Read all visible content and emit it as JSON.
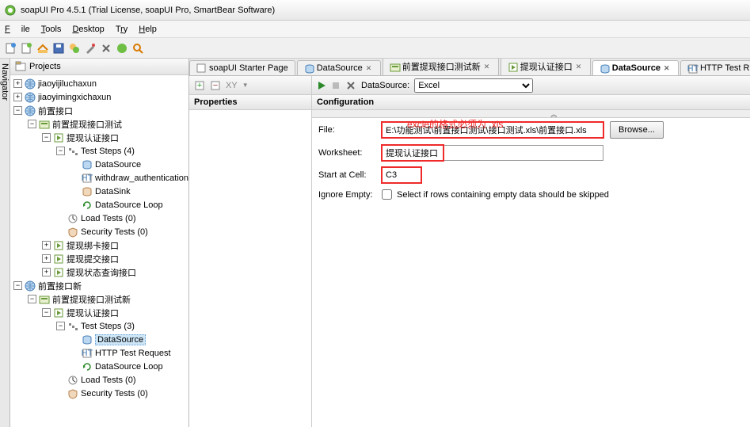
{
  "title": "soapUI Pro 4.5.1 (Trial License, soapUI Pro, SmartBear Software)",
  "menu": {
    "file": "File",
    "tools": "Tools",
    "desktop": "Desktop",
    "try": "Try",
    "help": "Help"
  },
  "navStrip": "Navigator",
  "treeHeader": "Projects",
  "tree": [
    {
      "d": 0,
      "t": "+",
      "i": "globe",
      "l": "jiaoyijiluchaxun"
    },
    {
      "d": 0,
      "t": "+",
      "i": "globe",
      "l": "jiaoyimingxichaxun"
    },
    {
      "d": 0,
      "t": "-",
      "i": "globe",
      "l": "前置接口"
    },
    {
      "d": 1,
      "t": "-",
      "i": "iface",
      "l": "前置提现接口测试"
    },
    {
      "d": 2,
      "t": "-",
      "i": "op",
      "l": "提现认证接口"
    },
    {
      "d": 3,
      "t": "-",
      "i": "steps",
      "l": "Test Steps (4)"
    },
    {
      "d": 4,
      "t": "",
      "i": "ds",
      "l": "DataSource"
    },
    {
      "d": 4,
      "t": "",
      "i": "req",
      "l": "withdraw_authentication"
    },
    {
      "d": 4,
      "t": "",
      "i": "sink",
      "l": "DataSink"
    },
    {
      "d": 4,
      "t": "",
      "i": "loop",
      "l": "DataSource Loop"
    },
    {
      "d": 3,
      "t": "",
      "i": "load",
      "l": "Load Tests (0)"
    },
    {
      "d": 3,
      "t": "",
      "i": "sec",
      "l": "Security Tests (0)"
    },
    {
      "d": 2,
      "t": "+",
      "i": "op",
      "l": "提现绑卡接口"
    },
    {
      "d": 2,
      "t": "+",
      "i": "op",
      "l": "提现提交接口"
    },
    {
      "d": 2,
      "t": "+",
      "i": "op",
      "l": "提现状态查询接口"
    },
    {
      "d": 0,
      "t": "-",
      "i": "globe",
      "l": "前置接口新"
    },
    {
      "d": 1,
      "t": "-",
      "i": "iface",
      "l": "前置提现接口测试新"
    },
    {
      "d": 2,
      "t": "-",
      "i": "op",
      "l": "提现认证接口"
    },
    {
      "d": 3,
      "t": "-",
      "i": "steps",
      "l": "Test Steps (3)"
    },
    {
      "d": 4,
      "t": "",
      "i": "ds",
      "l": "DataSource",
      "sel": true
    },
    {
      "d": 4,
      "t": "",
      "i": "req",
      "l": "HTTP Test Request"
    },
    {
      "d": 4,
      "t": "",
      "i": "loop",
      "l": "DataSource Loop"
    },
    {
      "d": 3,
      "t": "",
      "i": "load",
      "l": "Load Tests (0)"
    },
    {
      "d": 3,
      "t": "",
      "i": "sec",
      "l": "Security Tests (0)"
    }
  ],
  "tabs": [
    {
      "l": "soapUI Starter Page",
      "i": "page",
      "a": false
    },
    {
      "l": "DataSource",
      "i": "ds",
      "a": false,
      "c": true
    },
    {
      "l": "前置提现接口测试新",
      "i": "iface",
      "a": false,
      "c": true
    },
    {
      "l": "提现认证接口",
      "i": "op",
      "a": false,
      "c": true
    },
    {
      "l": "DataSource",
      "i": "ds",
      "a": true,
      "c": true
    },
    {
      "l": "HTTP Test Request",
      "i": "req",
      "a": false,
      "c": true
    }
  ],
  "panel": {
    "propsTitle": "Properties",
    "configTitle": "Configuration",
    "dsLabel": "DataSource:",
    "dsValue": "Excel",
    "annotation": "excle的格式必须为 .xls",
    "fileLabel": "File:",
    "fileValue": "E:\\功能测试\\前置接口测试\\接口测试.xls\\前置接口.xls",
    "browse": "Browse...",
    "wsLabel": "Worksheet:",
    "wsValue": "提现认证接口",
    "cellLabel": "Start at Cell:",
    "cellValue": "C3",
    "ignoreLabel": "Ignore Empty:",
    "ignoreText": "Select if rows containing empty data should be skipped"
  }
}
